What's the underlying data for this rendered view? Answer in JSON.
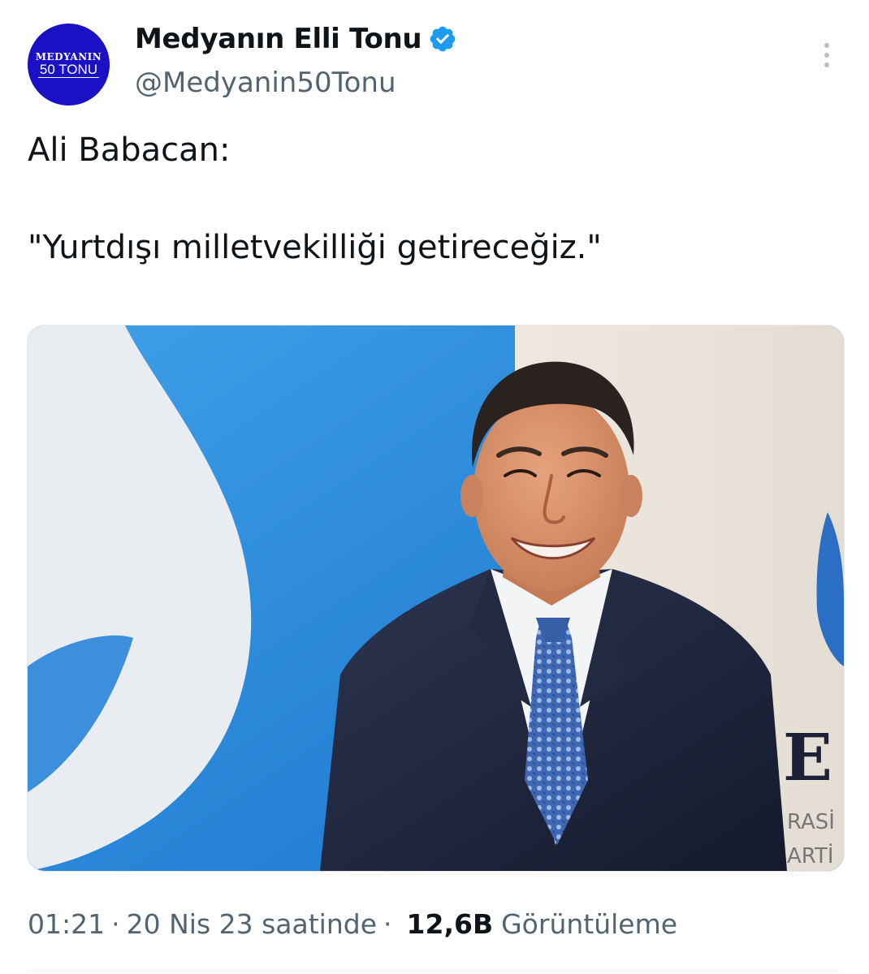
{
  "author": {
    "avatar_line1": "MEDYANIN",
    "avatar_line2": "50 TONU",
    "display_name": "Medyanın Elli Tonu",
    "handle": "@Medyanin50Tonu",
    "verified": true,
    "avatar_color": "#1a10c6",
    "verified_color": "#1d9bf0"
  },
  "menu": {
    "icon": "more-vertical-icon"
  },
  "tweet": {
    "text": "Ali Babacan:\n\n\"Yurtdışı milletvekilliği getireceğiz.\"",
    "media_alt": "Ali Babacan"
  },
  "meta": {
    "time": "01:21",
    "date": "20 Nis 23 saatinde",
    "views_count": "12,6B",
    "views_label": "Görüntüleme",
    "separator": "·"
  },
  "media_text": {
    "bg_letters": "E",
    "bg_word1": "RASİ",
    "bg_word2": "ARTİ"
  }
}
